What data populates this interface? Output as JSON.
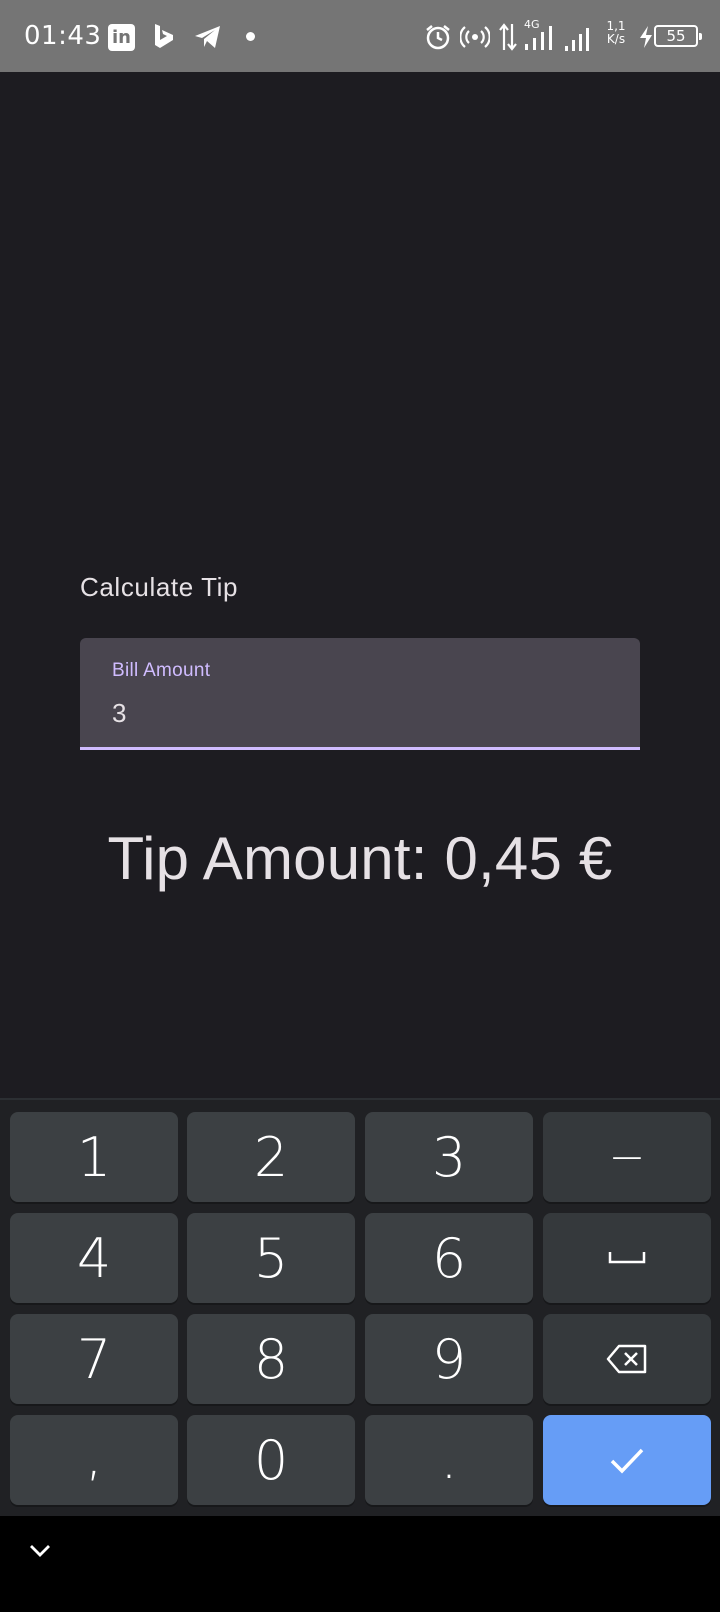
{
  "status_bar": {
    "time": "01:43",
    "linkedin_icon_text": "in",
    "data_speed": "1,1 K/s",
    "battery_level": "55",
    "network_label": "4G",
    "icons": [
      "linkedin-icon",
      "bing-icon",
      "telegram-icon",
      "dot-icon",
      "alarm-icon",
      "hotspot-icon",
      "data-arrows-icon",
      "signal-icon",
      "signal-icon",
      "charging-icon",
      "battery-icon"
    ]
  },
  "app": {
    "title": "Calculate Tip",
    "bill_field": {
      "label": "Bill Amount",
      "value": "3"
    },
    "tip_amount_text": "Tip Amount: 0,45 €"
  },
  "keyboard": {
    "rows": [
      [
        "1",
        "2",
        "3",
        "−"
      ],
      [
        "4",
        "5",
        "6",
        "space"
      ],
      [
        "7",
        "8",
        "9",
        "backspace"
      ],
      [
        ",",
        "0",
        ".",
        "enter"
      ]
    ],
    "labels": {
      "k1": "1",
      "k2": "2",
      "k3": "3",
      "k_minus": "−",
      "k4": "4",
      "k5": "5",
      "k6": "6",
      "k7": "7",
      "k8": "8",
      "k9": "9",
      "k_comma": ",",
      "k0": "0",
      "k_period": "."
    }
  },
  "colors": {
    "background": "#1d1c21",
    "field_background": "#49454f",
    "accent": "#d0bcff",
    "enter_key": "#669df6",
    "key": "#3c4043"
  }
}
